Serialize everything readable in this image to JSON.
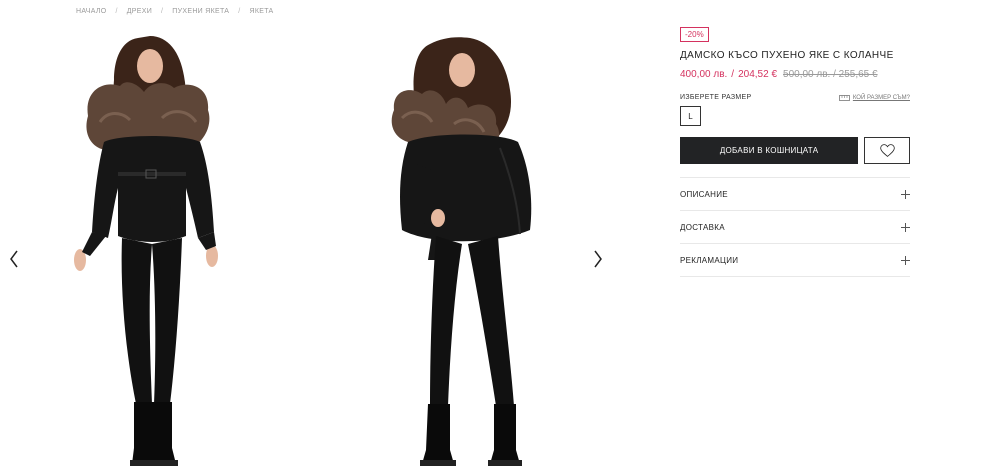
{
  "breadcrumb": {
    "items": [
      "НАЧАЛО",
      "ДРЕХИ",
      "ПУХЕНИ ЯКЕТА",
      "ЯКЕТА"
    ],
    "separator": "/"
  },
  "gallery": {
    "photos": [
      "product-photo-front",
      "product-photo-side"
    ],
    "prev_icon": "chevron-left-icon",
    "next_icon": "chevron-right-icon"
  },
  "product": {
    "discount_badge": "-20%",
    "title": "ДАМСКО КЪСО ПУХЕНО ЯКЕ С КОЛАНЧЕ",
    "price_bgn": "400,00 лв.",
    "price_sep": "/",
    "price_eur": "204,52 €",
    "old_price": "500,00 лв. / 255,65 €"
  },
  "size": {
    "label": "ИЗБЕРЕТЕ РАЗМЕР",
    "guide_label": "КОЙ РАЗМЕР СЪМ?",
    "guide_icon": "ruler-icon",
    "selected": "L"
  },
  "actions": {
    "add_to_cart": "ДОБАВИ В КОШНИЦАТА",
    "wishlist_icon": "heart-icon"
  },
  "accordion": [
    {
      "label": "ОПИСАНИЕ"
    },
    {
      "label": "ДОСТАВКА"
    },
    {
      "label": "РЕКЛАМАЦИИ"
    }
  ],
  "colors": {
    "accent": "#d4325f",
    "button_dark": "#222325",
    "text": "#1f1f1f",
    "muted": "#9a9a9a"
  }
}
